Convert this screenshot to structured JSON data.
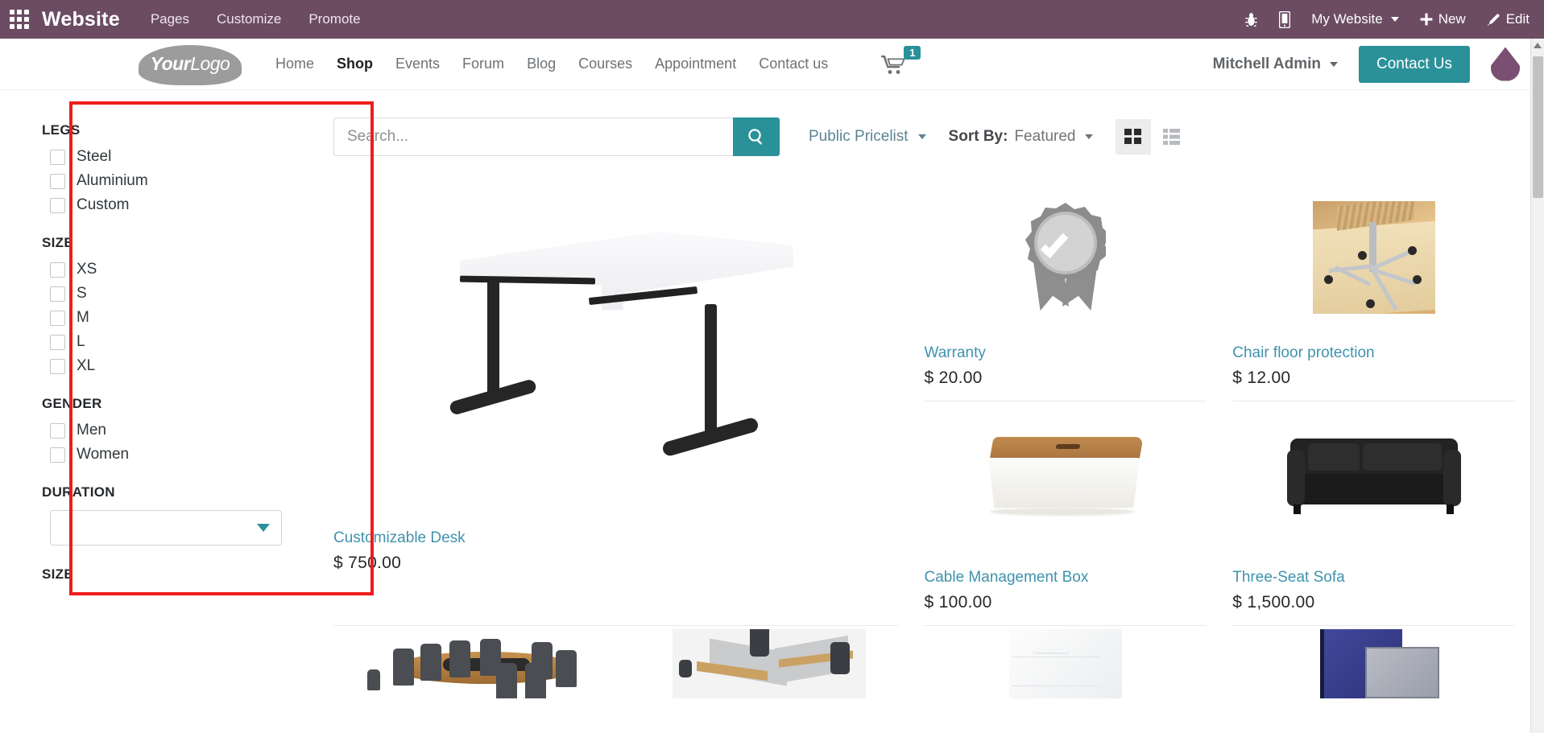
{
  "system_bar": {
    "apps_icon": "apps-grid-icon",
    "brand": "Website",
    "menus": [
      "Pages",
      "Customize",
      "Promote"
    ],
    "bug_icon": "bug-icon",
    "mobile_icon": "mobile-preview-icon",
    "website_selector": "My Website",
    "new_label": "New",
    "edit_label": "Edit",
    "bg_color": "#6b4c63"
  },
  "site_header": {
    "logo": {
      "primary": "Your",
      "secondary": "Logo"
    },
    "nav": [
      {
        "label": "Home",
        "active": false
      },
      {
        "label": "Shop",
        "active": true
      },
      {
        "label": "Events",
        "active": false
      },
      {
        "label": "Forum",
        "active": false
      },
      {
        "label": "Blog",
        "active": false
      },
      {
        "label": "Courses",
        "active": false
      },
      {
        "label": "Appointment",
        "active": false
      },
      {
        "label": "Contact us",
        "active": false
      }
    ],
    "cart": {
      "icon": "shopping-cart-icon",
      "count": "1",
      "badge_color": "#2a9199"
    },
    "user": "Mitchell Admin",
    "contact_button": "Contact Us",
    "accent_color": "#2a9199",
    "drop_icon": "water-drop-icon"
  },
  "sidebar": {
    "groups": [
      {
        "title": "LEGS",
        "type": "checkboxes",
        "options": [
          {
            "label": "Steel",
            "checked": false
          },
          {
            "label": "Aluminium",
            "checked": false
          },
          {
            "label": "Custom",
            "checked": false
          }
        ]
      },
      {
        "title": "SIZE",
        "type": "checkboxes",
        "options": [
          {
            "label": "XS",
            "checked": false
          },
          {
            "label": "S",
            "checked": false
          },
          {
            "label": "M",
            "checked": false
          },
          {
            "label": "L",
            "checked": false
          },
          {
            "label": "XL",
            "checked": false
          }
        ]
      },
      {
        "title": "GENDER",
        "type": "checkboxes",
        "options": [
          {
            "label": "Men",
            "checked": false
          },
          {
            "label": "Women",
            "checked": false
          }
        ]
      },
      {
        "title": "DURATION",
        "type": "select",
        "value": "",
        "placeholder": ""
      },
      {
        "title": "SIZE",
        "type": "heading-only",
        "options": []
      }
    ],
    "highlight_color": "#f01c1c"
  },
  "toolbar": {
    "search": {
      "value": "",
      "placeholder": "Search...",
      "button_icon": "search-icon"
    },
    "pricelist": "Public Pricelist",
    "sort_by_label": "Sort By:",
    "sort_by_value": "Featured",
    "grid_view_icon": "grid-view-icon",
    "list_view_icon": "list-view-icon",
    "active_view": "grid"
  },
  "products": [
    {
      "name": "Customizable Desk",
      "price": "$ 750.00",
      "image": "customizable-desk-image",
      "size": "large"
    },
    {
      "name": "Warranty",
      "price": "$ 20.00",
      "image": "warranty-badge-image",
      "size": "small"
    },
    {
      "name": "Chair floor protection",
      "price": "$ 12.00",
      "image": "chair-floor-protection-image",
      "size": "small"
    },
    {
      "name": "Cable Management Box",
      "price": "$ 100.00",
      "image": "cable-management-box-image",
      "size": "small"
    },
    {
      "name": "Three-Seat Sofa",
      "price": "$ 1,500.00",
      "image": "three-seat-sofa-image",
      "size": "small"
    }
  ],
  "products_partial_row": [
    {
      "image": "conference-table-image"
    },
    {
      "image": "office-workstation-image"
    },
    {
      "image": "drawer-unit-image"
    },
    {
      "image": "acoustic-panel-image"
    }
  ]
}
